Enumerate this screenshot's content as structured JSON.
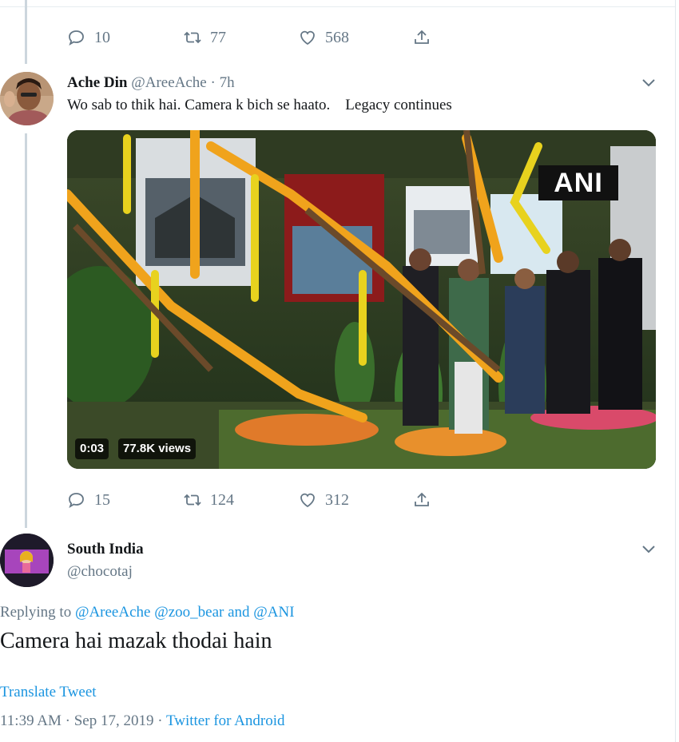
{
  "prev_tweet": {
    "reply_count": "10",
    "retweet_count": "77",
    "like_count": "568"
  },
  "tweet": {
    "display_name": "Ache Din",
    "handle": "@AreeAche",
    "dot": "·",
    "time": "7h",
    "text": "Wo sab to thik hai. Camera k bich se haato.    Legacy continues",
    "video": {
      "watermark": "ANI",
      "duration": "0:03",
      "views": "77.8K views"
    },
    "reply_count": "15",
    "retweet_count": "124",
    "like_count": "312"
  },
  "main_tweet": {
    "display_name": "South India",
    "handle": "@chocotaj",
    "replying_prefix": "Replying to",
    "replying_to": "@AreeAche @zoo_bear",
    "replying_and": "and",
    "replying_last": "@ANI",
    "text": "Camera hai mazak thodai hain",
    "translate": "Translate Tweet",
    "time": "11:39 AM",
    "sep1": "·",
    "date": "Sep 17, 2019",
    "sep2": "·",
    "source": "Twitter for Android"
  },
  "icons": [
    "reply-icon",
    "retweet-icon",
    "like-icon",
    "share-icon",
    "chevron-down-icon"
  ],
  "colors": {
    "link": "#1b95e0",
    "muted": "#657786",
    "text": "#14171a",
    "thread_line": "#ccd6dd"
  }
}
